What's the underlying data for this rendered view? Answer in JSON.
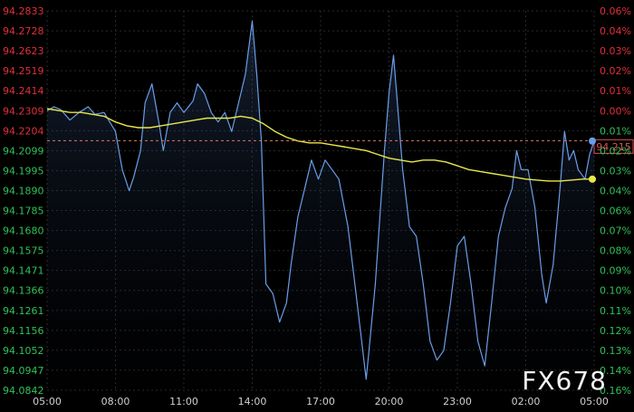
{
  "chart_data": {
    "type": "line",
    "title": "",
    "xlabel": "",
    "ylabel": "",
    "x_ticks": [
      "05:00",
      "08:00",
      "11:00",
      "14:00",
      "17:00",
      "20:00",
      "23:00",
      "02:00",
      "05:00"
    ],
    "xlim": [
      0,
      24
    ],
    "ylim": [
      94.0842,
      94.2833
    ],
    "reference_price": 94.2152,
    "current_price_label": "94.215",
    "left_ticks": [
      {
        "label": "94.2833",
        "value": 94.2833,
        "color": "#e0303a"
      },
      {
        "label": "94.2728",
        "value": 94.2728,
        "color": "#e0303a"
      },
      {
        "label": "94.2623",
        "value": 94.2623,
        "color": "#e0303a"
      },
      {
        "label": "94.2519",
        "value": 94.2519,
        "color": "#e0303a"
      },
      {
        "label": "94.2414",
        "value": 94.2414,
        "color": "#e0303a"
      },
      {
        "label": "94.2309",
        "value": 94.2309,
        "color": "#e0303a"
      },
      {
        "label": "94.2204",
        "value": 94.2204,
        "color": "#e0303a"
      },
      {
        "label": "94.2099",
        "value": 94.2099,
        "color": "#30c15a"
      },
      {
        "label": "94.1995",
        "value": 94.1995,
        "color": "#30c15a"
      },
      {
        "label": "94.1890",
        "value": 94.189,
        "color": "#30c15a"
      },
      {
        "label": "94.1785",
        "value": 94.1785,
        "color": "#30c15a"
      },
      {
        "label": "94.1680",
        "value": 94.168,
        "color": "#30c15a"
      },
      {
        "label": "94.1575",
        "value": 94.1575,
        "color": "#30c15a"
      },
      {
        "label": "94.1471",
        "value": 94.1471,
        "color": "#30c15a"
      },
      {
        "label": "94.1366",
        "value": 94.1366,
        "color": "#30c15a"
      },
      {
        "label": "94.1261",
        "value": 94.1261,
        "color": "#30c15a"
      },
      {
        "label": "94.1156",
        "value": 94.1156,
        "color": "#30c15a"
      },
      {
        "label": "94.1052",
        "value": 94.1052,
        "color": "#30c15a"
      },
      {
        "label": "94.0947",
        "value": 94.0947,
        "color": "#30c15a"
      },
      {
        "label": "94.0842",
        "value": 94.0842,
        "color": "#30c15a"
      }
    ],
    "right_ticks": [
      {
        "label": "0.06%",
        "color": "#e0303a"
      },
      {
        "label": "0.04%",
        "color": "#e0303a"
      },
      {
        "label": "0.03%",
        "color": "#e0303a"
      },
      {
        "label": "0.02%",
        "color": "#e0303a"
      },
      {
        "label": "0.01%",
        "color": "#e0303a"
      },
      {
        "label": "0.00%",
        "color": "#e0303a"
      },
      {
        "label": "0.01%",
        "color": "#30c15a"
      },
      {
        "label": "0.02%",
        "color": "#30c15a"
      },
      {
        "label": "0.03%",
        "color": "#30c15a"
      },
      {
        "label": "0.04%",
        "color": "#30c15a"
      },
      {
        "label": "0.06%",
        "color": "#30c15a"
      },
      {
        "label": "0.07%",
        "color": "#30c15a"
      },
      {
        "label": "0.08%",
        "color": "#30c15a"
      },
      {
        "label": "0.09%",
        "color": "#30c15a"
      },
      {
        "label": "0.10%",
        "color": "#30c15a"
      },
      {
        "label": "0.11%",
        "color": "#30c15a"
      },
      {
        "label": "0.12%",
        "color": "#30c15a"
      },
      {
        "label": "0.13%",
        "color": "#30c15a"
      },
      {
        "label": "0.14%",
        "color": "#30c15a"
      },
      {
        "label": "0.16%",
        "color": "#30c15a"
      }
    ],
    "series": [
      {
        "color": "#6a9de8",
        "points": [
          [
            0.0,
            94.2309
          ],
          [
            0.3,
            94.233
          ],
          [
            0.6,
            94.2315
          ],
          [
            1.0,
            94.226
          ],
          [
            1.4,
            94.23
          ],
          [
            1.8,
            94.233
          ],
          [
            2.1,
            94.229
          ],
          [
            2.5,
            94.23
          ],
          [
            3.0,
            94.22
          ],
          [
            3.3,
            94.2
          ],
          [
            3.6,
            94.189
          ],
          [
            3.8,
            94.196
          ],
          [
            4.1,
            94.21
          ],
          [
            4.3,
            94.235
          ],
          [
            4.6,
            94.245
          ],
          [
            4.9,
            94.225
          ],
          [
            5.1,
            94.21
          ],
          [
            5.4,
            94.23
          ],
          [
            5.7,
            94.235
          ],
          [
            6.0,
            94.23
          ],
          [
            6.4,
            94.236
          ],
          [
            6.6,
            94.245
          ],
          [
            6.9,
            94.24
          ],
          [
            7.2,
            94.23
          ],
          [
            7.5,
            94.225
          ],
          [
            7.8,
            94.23
          ],
          [
            8.1,
            94.22
          ],
          [
            8.4,
            94.235
          ],
          [
            8.7,
            94.25
          ],
          [
            9.0,
            94.278
          ],
          [
            9.2,
            94.25
          ],
          [
            9.4,
            94.215
          ],
          [
            9.6,
            94.14
          ],
          [
            9.9,
            94.135
          ],
          [
            10.2,
            94.12
          ],
          [
            10.5,
            94.13
          ],
          [
            10.7,
            94.15
          ],
          [
            11.0,
            94.175
          ],
          [
            11.3,
            94.19
          ],
          [
            11.6,
            94.205
          ],
          [
            11.9,
            94.195
          ],
          [
            12.2,
            94.205
          ],
          [
            12.5,
            94.2
          ],
          [
            12.8,
            94.195
          ],
          [
            13.2,
            94.17
          ],
          [
            13.5,
            94.14
          ],
          [
            13.8,
            94.11
          ],
          [
            14.0,
            94.09
          ],
          [
            14.2,
            94.115
          ],
          [
            14.4,
            94.14
          ],
          [
            14.6,
            94.175
          ],
          [
            14.8,
            94.21
          ],
          [
            15.0,
            94.24
          ],
          [
            15.2,
            94.26
          ],
          [
            15.4,
            94.23
          ],
          [
            15.6,
            94.2
          ],
          [
            15.9,
            94.17
          ],
          [
            16.2,
            94.165
          ],
          [
            16.5,
            94.14
          ],
          [
            16.8,
            94.11
          ],
          [
            17.1,
            94.1
          ],
          [
            17.4,
            94.105
          ],
          [
            17.7,
            94.13
          ],
          [
            18.0,
            94.16
          ],
          [
            18.3,
            94.165
          ],
          [
            18.6,
            94.14
          ],
          [
            18.9,
            94.11
          ],
          [
            19.2,
            94.097
          ],
          [
            19.5,
            94.13
          ],
          [
            19.8,
            94.165
          ],
          [
            20.1,
            94.18
          ],
          [
            20.4,
            94.19
          ],
          [
            20.6,
            94.21
          ],
          [
            20.8,
            94.2
          ],
          [
            21.1,
            94.2
          ],
          [
            21.4,
            94.18
          ],
          [
            21.7,
            94.145
          ],
          [
            21.9,
            94.13
          ],
          [
            22.2,
            94.15
          ],
          [
            22.5,
            94.19
          ],
          [
            22.7,
            94.22
          ],
          [
            22.9,
            94.205
          ],
          [
            23.1,
            94.21
          ],
          [
            23.3,
            94.2
          ],
          [
            23.6,
            94.195
          ],
          [
            23.8,
            94.208
          ],
          [
            24.0,
            94.215
          ]
        ]
      },
      {
        "color": "#e8e84a",
        "points": [
          [
            0.0,
            94.232
          ],
          [
            0.5,
            94.231
          ],
          [
            1.0,
            94.23
          ],
          [
            1.5,
            94.23
          ],
          [
            2.0,
            94.229
          ],
          [
            2.5,
            94.228
          ],
          [
            3.0,
            94.225
          ],
          [
            3.5,
            94.223
          ],
          [
            4.0,
            94.222
          ],
          [
            4.5,
            94.222
          ],
          [
            5.0,
            94.223
          ],
          [
            5.5,
            94.224
          ],
          [
            6.0,
            94.225
          ],
          [
            6.5,
            94.226
          ],
          [
            7.0,
            94.227
          ],
          [
            7.5,
            94.227
          ],
          [
            8.0,
            94.227
          ],
          [
            8.5,
            94.228
          ],
          [
            9.0,
            94.227
          ],
          [
            9.5,
            94.224
          ],
          [
            10.0,
            94.22
          ],
          [
            10.5,
            94.217
          ],
          [
            11.0,
            94.215
          ],
          [
            11.5,
            94.214
          ],
          [
            12.0,
            94.214
          ],
          [
            12.5,
            94.213
          ],
          [
            13.0,
            94.212
          ],
          [
            13.5,
            94.211
          ],
          [
            14.0,
            94.21
          ],
          [
            14.5,
            94.208
          ],
          [
            15.0,
            94.206
          ],
          [
            15.5,
            94.205
          ],
          [
            16.0,
            94.204
          ],
          [
            16.5,
            94.205
          ],
          [
            17.0,
            94.205
          ],
          [
            17.5,
            94.204
          ],
          [
            18.0,
            94.202
          ],
          [
            18.5,
            94.2
          ],
          [
            19.0,
            94.199
          ],
          [
            19.5,
            94.198
          ],
          [
            20.0,
            94.197
          ],
          [
            20.5,
            94.196
          ],
          [
            21.0,
            94.195
          ],
          [
            21.5,
            94.1945
          ],
          [
            22.0,
            94.194
          ],
          [
            22.5,
            94.194
          ],
          [
            23.0,
            94.1945
          ],
          [
            23.5,
            94.195
          ],
          [
            24.0,
            94.195
          ]
        ]
      }
    ]
  },
  "watermark": "FX678"
}
